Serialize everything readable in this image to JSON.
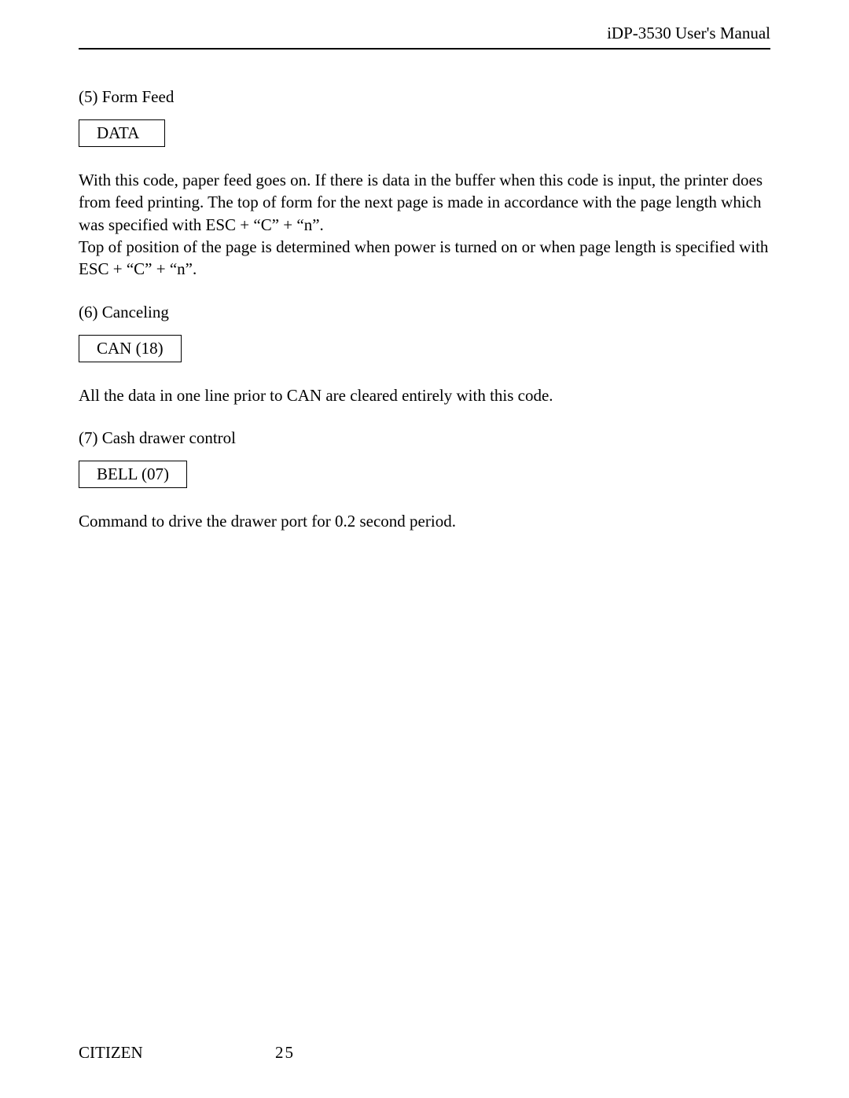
{
  "header": {
    "title": "iDP-3530 User's Manual"
  },
  "sections": {
    "s5": {
      "title": "(5)  Form Feed",
      "code": "DATA",
      "para1": "With this code, paper feed goes on. If there is data in the buffer when this code is input, the printer does from feed printing. The top of form for the next page is made in accordance with the page length which was specified with ESC + “C” + “n”.",
      "para2": "Top of position of the page is determined when power is turned on or when page length is specified with ESC + “C” + “n”."
    },
    "s6": {
      "title": "(6)  Canceling",
      "code": "CAN (18)",
      "para1": "All the data in one line prior to CAN are cleared entirely with this code."
    },
    "s7": {
      "title": "(7)  Cash drawer control",
      "code": "BELL (07)",
      "para1": "Command to drive the drawer port for 0.2 second period."
    }
  },
  "footer": {
    "brand": "CITIZEN",
    "page": "25"
  }
}
